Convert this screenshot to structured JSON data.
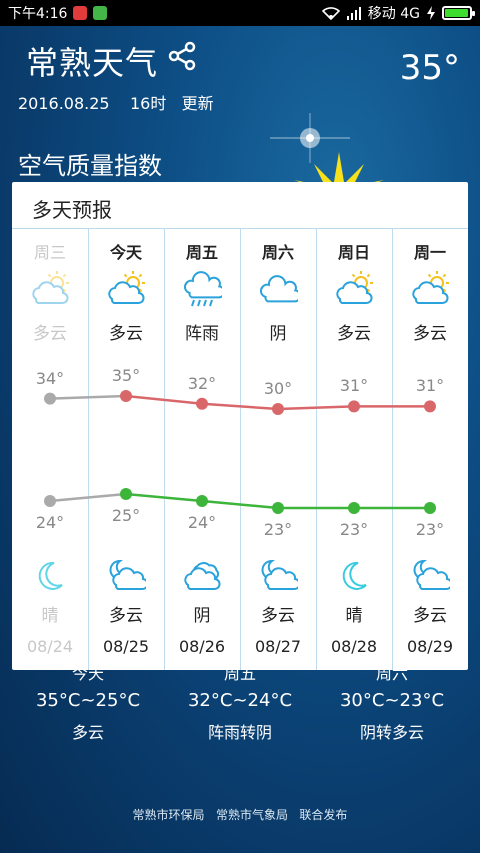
{
  "status": {
    "time": "下午4:16",
    "carrier": "移动 4G"
  },
  "header": {
    "city": "常熟天气",
    "temp": "35°",
    "date": "2016.08.25    16时   更新",
    "aqi_title": "空气质量指数"
  },
  "forecast": {
    "title": "多天预报",
    "days": [
      {
        "day": "周三",
        "icon_top": "partly-cloudy-sun-icon",
        "cond_top": "多云",
        "hi": "34°",
        "lo": "24°",
        "hi_val": 34,
        "lo_val": 24,
        "icon_bot": "moon-icon",
        "cond_bot": "晴",
        "date": "08/24",
        "past": true
      },
      {
        "day": "今天",
        "icon_top": "partly-cloudy-sun-icon",
        "cond_top": "多云",
        "hi": "35°",
        "lo": "25°",
        "hi_val": 35,
        "lo_val": 25,
        "icon_bot": "cloudy-moon-icon",
        "cond_bot": "多云",
        "date": "08/25",
        "past": false
      },
      {
        "day": "周五",
        "icon_top": "shower-icon",
        "cond_top": "阵雨",
        "hi": "32°",
        "lo": "24°",
        "hi_val": 32,
        "lo_val": 24,
        "icon_bot": "overcast-icon",
        "cond_bot": "阴",
        "date": "08/26",
        "past": false
      },
      {
        "day": "周六",
        "icon_top": "cloud-icon",
        "cond_top": "阴",
        "hi": "30°",
        "lo": "23°",
        "hi_val": 30,
        "lo_val": 23,
        "icon_bot": "cloudy-moon-icon",
        "cond_bot": "多云",
        "date": "08/27",
        "past": false
      },
      {
        "day": "周日",
        "icon_top": "partly-cloudy-sun-icon",
        "cond_top": "多云",
        "hi": "31°",
        "lo": "23°",
        "hi_val": 31,
        "lo_val": 23,
        "icon_bot": "moon-icon",
        "cond_bot": "晴",
        "date": "08/28",
        "past": false
      },
      {
        "day": "周一",
        "icon_top": "partly-cloudy-sun-icon",
        "cond_top": "多云",
        "hi": "31°",
        "lo": "23°",
        "hi_val": 31,
        "lo_val": 23,
        "icon_bot": "cloudy-moon-icon",
        "cond_bot": "多云",
        "date": "08/29",
        "past": false
      }
    ]
  },
  "summary": [
    {
      "day": "今天",
      "range": "35°C~25°C",
      "cond": "多云"
    },
    {
      "day": "周五",
      "range": "32°C~24°C",
      "cond": "阵雨转阴"
    },
    {
      "day": "周六",
      "range": "30°C~23°C",
      "cond": "阴转多云"
    }
  ],
  "footer": "常熟市环保局   常熟市气象局   联合发布",
  "colors": {
    "high_line": "#d9676a",
    "low_line": "#3db43a",
    "past_line": "#aaaaaa",
    "battery": "#3ddc2f"
  },
  "battery_level": 0.95
}
